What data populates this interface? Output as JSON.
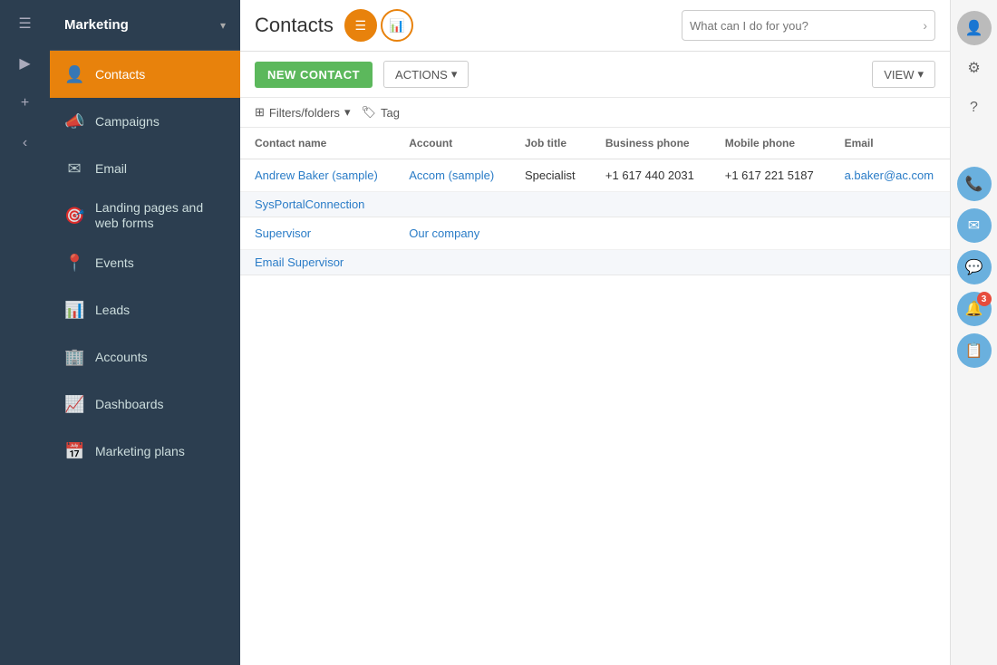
{
  "leftToolbar": {
    "menuIcon": "☰",
    "playIcon": "▶",
    "addIcon": "+",
    "backIcon": "‹"
  },
  "sidebar": {
    "title": "Marketing",
    "items": [
      {
        "id": "contacts",
        "label": "Contacts",
        "icon": "👤",
        "active": true
      },
      {
        "id": "campaigns",
        "label": "Campaigns",
        "icon": "📣",
        "active": false
      },
      {
        "id": "email",
        "label": "Email",
        "icon": "✉",
        "active": false
      },
      {
        "id": "landing-pages",
        "label": "Landing pages and web forms",
        "icon": "🎯",
        "active": false
      },
      {
        "id": "events",
        "label": "Events",
        "icon": "📍",
        "active": false
      },
      {
        "id": "leads",
        "label": "Leads",
        "icon": "📊",
        "active": false
      },
      {
        "id": "accounts",
        "label": "Accounts",
        "icon": "🏢",
        "active": false
      },
      {
        "id": "dashboards",
        "label": "Dashboards",
        "icon": "📈",
        "active": false
      },
      {
        "id": "marketing-plans",
        "label": "Marketing plans",
        "icon": "📅",
        "active": false
      }
    ]
  },
  "header": {
    "title": "Contacts",
    "searchPlaceholder": "What can I do for you?"
  },
  "toolbar": {
    "newContactLabel": "NEW CONTACT",
    "actionsLabel": "ACTIONS",
    "viewLabel": "VIEW",
    "filtersLabel": "Filters/folders",
    "tagLabel": "Tag"
  },
  "table": {
    "columns": [
      "Contact name",
      "Account",
      "Job title",
      "Business phone",
      "Mobile phone",
      "Email"
    ],
    "rows": [
      {
        "type": "data",
        "contactName": "Andrew Baker (sample)",
        "account": "Accom (sample)",
        "jobTitle": "Specialist",
        "businessPhone": "+1 617 440 2031",
        "mobilePhone": "+1 617 221 5187",
        "email": "a.baker@ac.com"
      },
      {
        "type": "group",
        "groupName": "SysPortalConnection",
        "contactName": "",
        "account": "",
        "jobTitle": "",
        "businessPhone": "",
        "mobilePhone": "",
        "email": ""
      },
      {
        "type": "data",
        "contactName": "Supervisor",
        "account": "Our company",
        "jobTitle": "",
        "businessPhone": "",
        "mobilePhone": "",
        "email": ""
      },
      {
        "type": "group",
        "groupName": "Email Supervisor",
        "contactName": "",
        "account": "",
        "jobTitle": "",
        "businessPhone": "",
        "mobilePhone": "",
        "email": ""
      }
    ]
  },
  "rightPanel": {
    "gearIcon": "⚙",
    "helpIcon": "?",
    "phoneIcon": "📞",
    "emailIcon": "✉",
    "chatIcon": "💬",
    "notificationIcon": "🔔",
    "notificationBadge": "3",
    "noteIcon": "📋"
  }
}
